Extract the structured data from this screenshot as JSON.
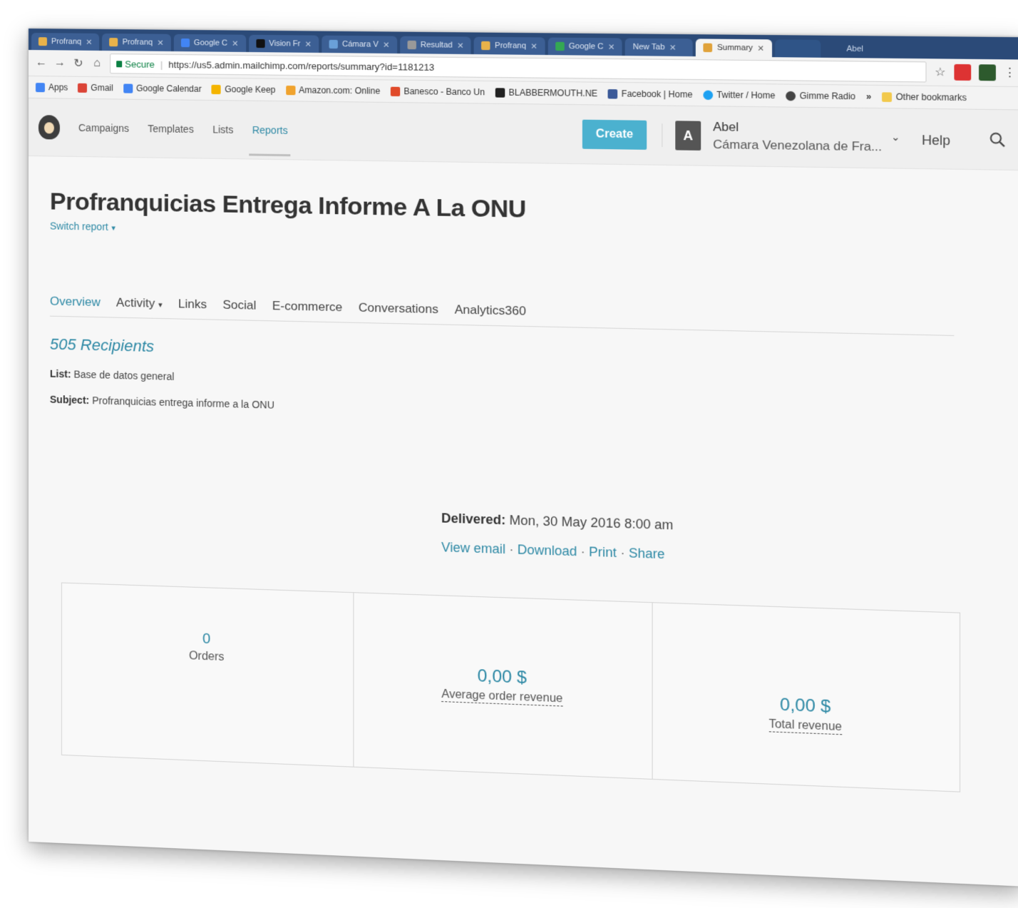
{
  "browser": {
    "tabs": [
      {
        "label": "Profranq",
        "active": false
      },
      {
        "label": "Profranq",
        "active": false
      },
      {
        "label": "Google C",
        "active": false
      },
      {
        "label": "Vision Fr",
        "active": false
      },
      {
        "label": "Cámara V",
        "active": false
      },
      {
        "label": "Resultad",
        "active": false
      },
      {
        "label": "Profranq",
        "active": false
      },
      {
        "label": "Google C",
        "active": false
      },
      {
        "label": "New Tab",
        "active": false
      },
      {
        "label": "Summary",
        "active": true
      }
    ],
    "user_tab_label": "Abel",
    "secure_label": "Secure",
    "url": "https://us5.admin.mailchimp.com/reports/summary?id=1181213",
    "bookmarks": [
      {
        "label": "Apps",
        "color": "#f4b400"
      },
      {
        "label": "Gmail",
        "color": "#db4437"
      },
      {
        "label": "Google Calendar",
        "color": "#4285f4"
      },
      {
        "label": "Google Keep",
        "color": "#f4b400"
      },
      {
        "label": "Amazon.com: Online",
        "color": "#f0a32e"
      },
      {
        "label": "Banesco - Banco Un",
        "color": "#e04a2a"
      },
      {
        "label": "BLABBERMOUTH.NE",
        "color": "#222222"
      },
      {
        "label": "Facebook | Home",
        "color": "#3b5998"
      },
      {
        "label": "Twitter / Home",
        "color": "#1da1f2"
      },
      {
        "label": "Gimme Radio",
        "color": "#444444"
      }
    ],
    "bookmarks_more": "»",
    "other_bookmarks": "Other bookmarks"
  },
  "header": {
    "nav": [
      "Campaigns",
      "Templates",
      "Lists",
      "Reports"
    ],
    "active_nav": "Reports",
    "create_label": "Create",
    "avatar_letter": "A",
    "account_name": "Abel",
    "account_org": "Cámara Venezolana de Fra...",
    "help_label": "Help"
  },
  "report": {
    "title": "Profranquicias Entrega Informe A La ONU",
    "switch_label": "Switch report",
    "tabs": [
      "Overview",
      "Activity",
      "Links",
      "Social",
      "E-commerce",
      "Conversations",
      "Analytics360"
    ],
    "recipients": "505 Recipients",
    "list_label": "List:",
    "list_value": "Base de datos general",
    "subject_label": "Subject:",
    "subject_value": "Profranquicias entrega informe a la ONU",
    "delivered_label": "Delivered:",
    "delivered_value": "Mon, 30 May 2016 8:00 am",
    "actions": [
      "View email",
      "Download",
      "Print",
      "Share"
    ],
    "stats": [
      {
        "value": "0",
        "label": "Orders"
      },
      {
        "value": "0,00 $",
        "label": "Average order revenue"
      },
      {
        "value": "0,00 $",
        "label": "Total revenue"
      }
    ]
  },
  "colors": {
    "accent": "#2e89a5",
    "create_button": "#4bb1cf"
  }
}
